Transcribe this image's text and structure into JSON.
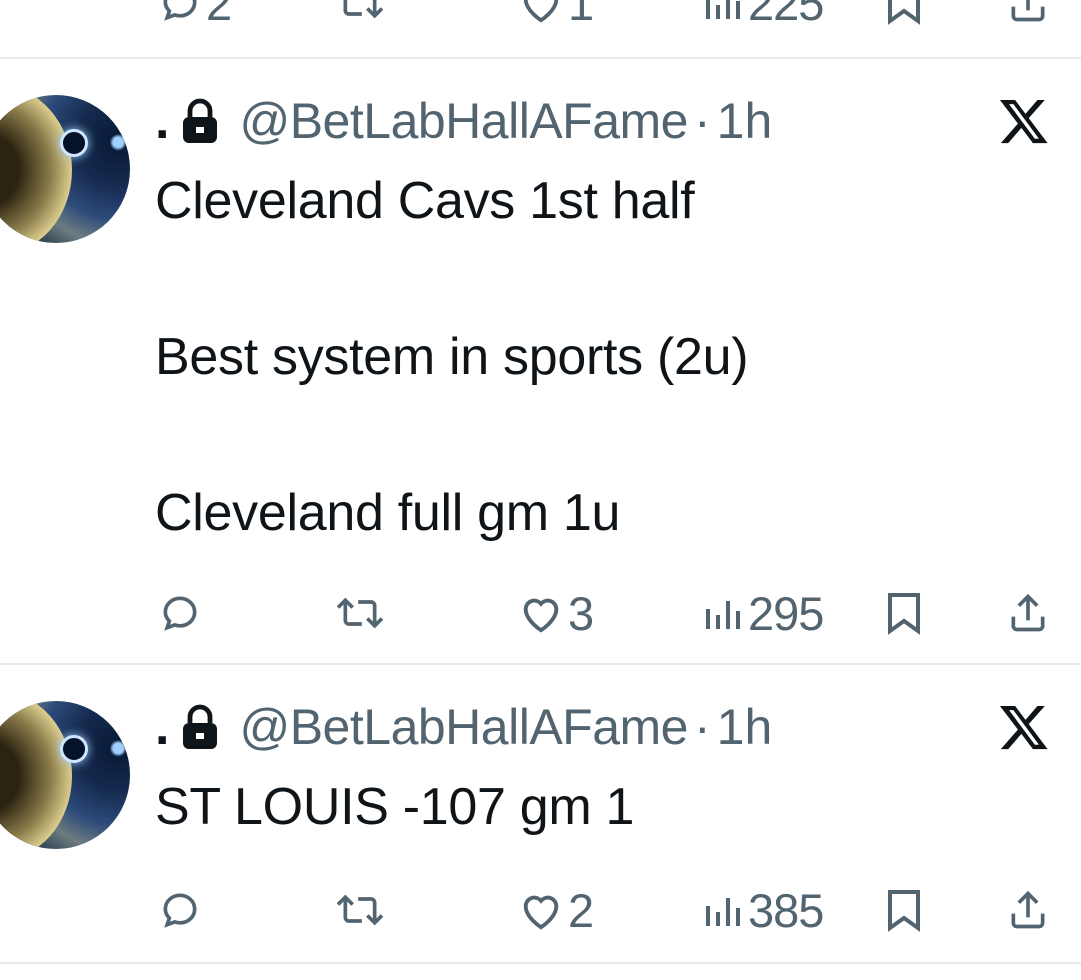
{
  "previous_tweet": {
    "actions": {
      "reply_count": "2",
      "retweet_count": "",
      "like_count": "1",
      "view_count": "225"
    }
  },
  "tweets": [
    {
      "display_name": ".",
      "handle": "@BetLabHallAFame",
      "separator": "·",
      "time": "1h",
      "text": "Cleveland Cavs 1st half\n\nBest system in sports (2u)\n\nCleveland full gm 1u",
      "actions": {
        "reply_count": "",
        "retweet_count": "",
        "like_count": "3",
        "view_count": "295"
      }
    },
    {
      "display_name": ".",
      "handle": "@BetLabHallAFame",
      "separator": "·",
      "time": "1h",
      "text": "ST LOUIS -107 gm 1",
      "actions": {
        "reply_count": "",
        "retweet_count": "",
        "like_count": "2",
        "view_count": "385"
      }
    }
  ],
  "icons": {
    "reply": "speech-bubble-icon",
    "retweet": "retweet-icon",
    "like": "heart-icon",
    "views": "bar-chart-icon",
    "bookmark": "bookmark-icon",
    "share": "share-icon",
    "lock": "lock-icon",
    "platform": "x-logo-icon"
  },
  "colors": {
    "text": "#0f1419",
    "muted": "#536471",
    "divider": "#e7e9ea",
    "background": "#ffffff"
  }
}
